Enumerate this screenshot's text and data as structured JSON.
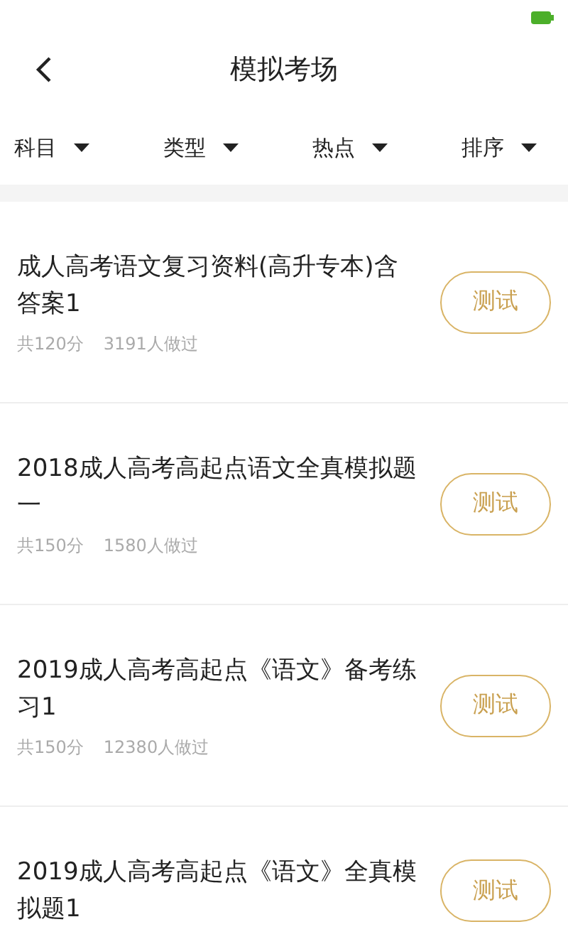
{
  "header": {
    "title": "模拟考场"
  },
  "filters": [
    {
      "label": "科目"
    },
    {
      "label": "类型"
    },
    {
      "label": "热点"
    },
    {
      "label": "排序"
    }
  ],
  "exams": [
    {
      "title": "成人高考语文复习资料(高升专本)含答案1",
      "score": "共120分",
      "takers": "3191人做过",
      "action": "测试"
    },
    {
      "title": "2018成人高考高起点语文全真模拟题一",
      "score": "共150分",
      "takers": "1580人做过",
      "action": "测试"
    },
    {
      "title": "2019成人高考高起点《语文》备考练习1",
      "score": "共150分",
      "takers": "12380人做过",
      "action": "测试"
    },
    {
      "title": "2019成人高考高起点《语文》全真模拟题1",
      "action": "测试"
    }
  ]
}
